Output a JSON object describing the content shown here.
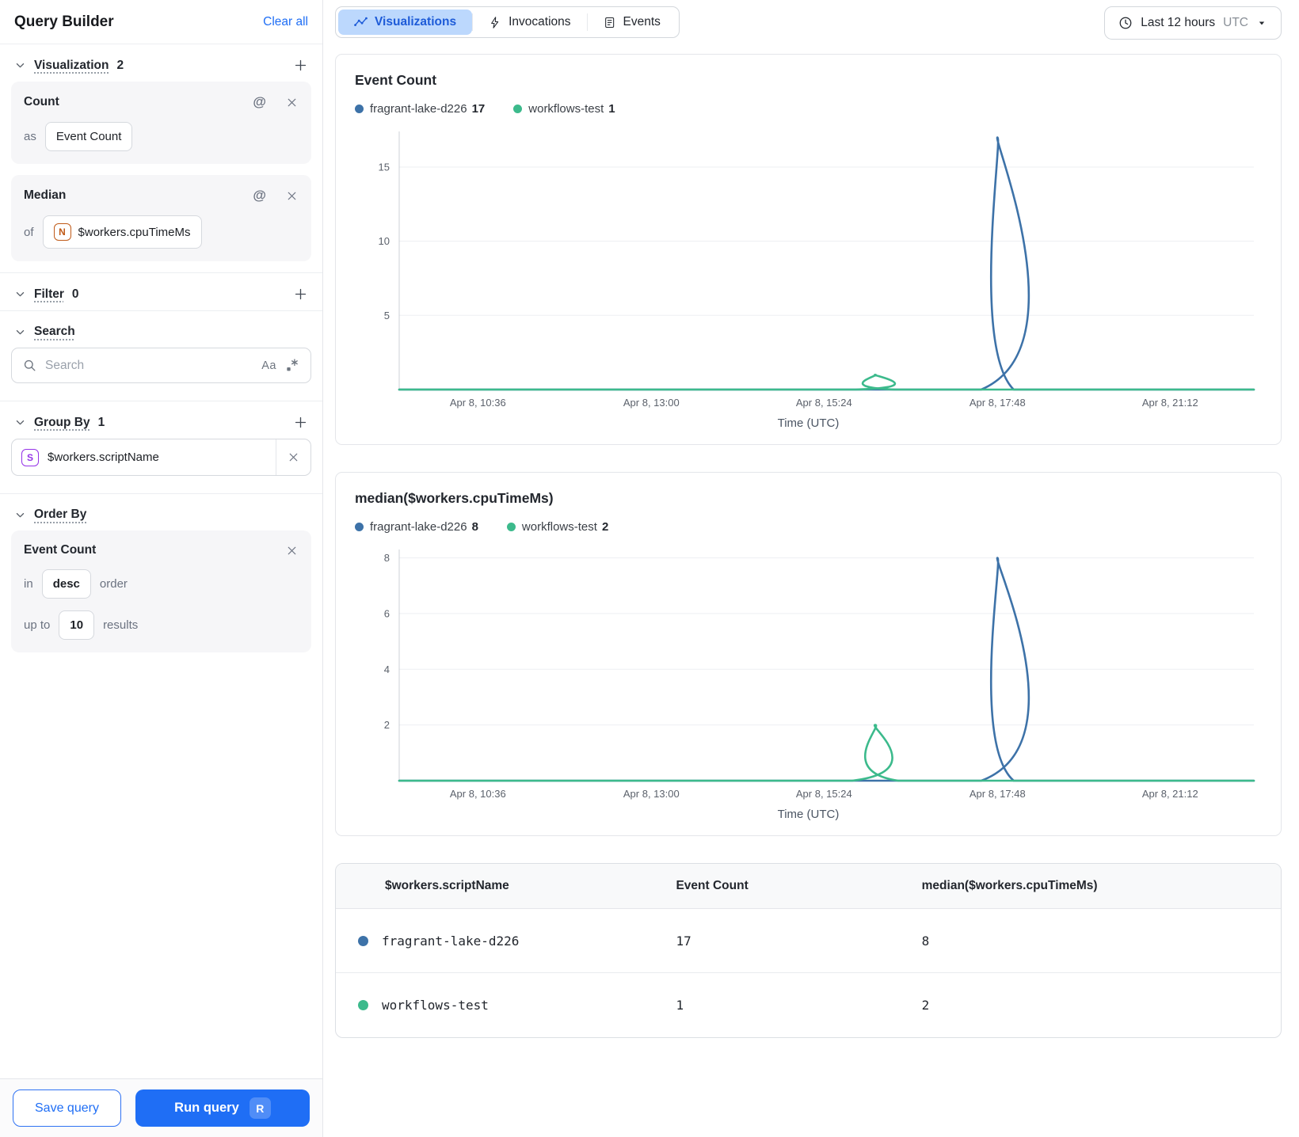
{
  "sidebar": {
    "title": "Query Builder",
    "clear_all_label": "Clear all",
    "visualization_section": {
      "label": "Visualization",
      "count": "2"
    },
    "visualization_cards": [
      {
        "title": "Count",
        "prefix": "as",
        "value": "Event Count",
        "value_icon": ""
      },
      {
        "title": "Median",
        "prefix": "of",
        "value": "$workers.cpuTimeMs",
        "value_icon": "N"
      }
    ],
    "filter_section": {
      "label": "Filter",
      "count": "0"
    },
    "search_section": {
      "label": "Search",
      "placeholder": "Search",
      "match_case_icon": "Aa"
    },
    "group_by_section": {
      "label": "Group By",
      "count": "1",
      "items": [
        {
          "icon": "S",
          "value": "$workers.scriptName"
        }
      ]
    },
    "order_by_section": {
      "label": "Order By",
      "card": {
        "title": "Event Count",
        "in_label": "in",
        "direction": "desc",
        "order_label": "order",
        "up_to_label": "up to",
        "limit": "10",
        "results_label": "results"
      }
    },
    "footer": {
      "save_label": "Save query",
      "run_label": "Run query",
      "run_shortcut": "R"
    }
  },
  "header": {
    "tabs": [
      {
        "label": "Visualizations",
        "active": true
      },
      {
        "label": "Invocations",
        "active": false
      },
      {
        "label": "Events",
        "active": false
      }
    ],
    "time_range": {
      "label": "Last 12 hours",
      "timezone": "UTC"
    }
  },
  "chart_data": [
    {
      "type": "line",
      "title": "Event Count",
      "xlabel": "Time (UTC)",
      "x_ticks": [
        "Apr 8, 10:36",
        "Apr 8, 13:00",
        "Apr 8, 15:24",
        "Apr 8, 17:48",
        "Apr 8, 21:12"
      ],
      "x_tick_pos": [
        0.092,
        0.295,
        0.497,
        0.7,
        0.902
      ],
      "y_ticks": [
        5,
        10,
        15
      ],
      "ylim": [
        0,
        17.4
      ],
      "grid": true,
      "legend_position": "top",
      "legend": [
        {
          "name": "fragrant-lake-d226",
          "value": "17",
          "color": "#3d72a8"
        },
        {
          "name": "workflows-test",
          "value": "1",
          "color": "#3cba8c"
        }
      ],
      "series": [
        {
          "name": "fragrant-lake-d226",
          "color": "#3d72a8",
          "points": [
            [
              0,
              0
            ],
            [
              0.681,
              0
            ],
            [
              0.7,
              17
            ],
            [
              0.719,
              0
            ],
            [
              1,
              0
            ]
          ]
        },
        {
          "name": "workflows-test",
          "color": "#3cba8c",
          "points": [
            [
              0,
              0
            ],
            [
              0.534,
              0
            ],
            [
              0.557,
              1
            ],
            [
              0.58,
              0
            ],
            [
              1,
              0
            ]
          ]
        }
      ]
    },
    {
      "type": "line",
      "title": "median($workers.cpuTimeMs)",
      "xlabel": "Time (UTC)",
      "x_ticks": [
        "Apr 8, 10:36",
        "Apr 8, 13:00",
        "Apr 8, 15:24",
        "Apr 8, 17:48",
        "Apr 8, 21:12"
      ],
      "x_tick_pos": [
        0.092,
        0.295,
        0.497,
        0.7,
        0.902
      ],
      "y_ticks": [
        2,
        4,
        6,
        8
      ],
      "ylim": [
        0,
        8.3
      ],
      "grid": true,
      "legend_position": "top",
      "legend": [
        {
          "name": "fragrant-lake-d226",
          "value": "8",
          "color": "#3d72a8"
        },
        {
          "name": "workflows-test",
          "value": "2",
          "color": "#3cba8c"
        }
      ],
      "series": [
        {
          "name": "fragrant-lake-d226",
          "color": "#3d72a8",
          "points": [
            [
              0,
              0
            ],
            [
              0.681,
              0
            ],
            [
              0.7,
              8
            ],
            [
              0.719,
              0
            ],
            [
              1,
              0
            ]
          ]
        },
        {
          "name": "workflows-test",
          "color": "#3cba8c",
          "points": [
            [
              0,
              0
            ],
            [
              0.53,
              0
            ],
            [
              0.557,
              2
            ],
            [
              0.584,
              0
            ],
            [
              1,
              0
            ]
          ]
        }
      ]
    }
  ],
  "table": {
    "columns": [
      "$workers.scriptName",
      "Event Count",
      "median($workers.cpuTimeMs)"
    ],
    "rows": [
      {
        "color": "#3d72a8",
        "script_name": "fragrant-lake-d226",
        "event_count": "17",
        "median": "8"
      },
      {
        "color": "#3cba8c",
        "script_name": "workflows-test",
        "event_count": "1",
        "median": "2"
      }
    ]
  },
  "colors": {
    "primary_blue": "#1f6ef5",
    "active_tab_bg": "#bcd8fd",
    "active_tab_text": "#1d5bd8",
    "series_blue": "#3d72a8",
    "series_green": "#3cba8c"
  }
}
